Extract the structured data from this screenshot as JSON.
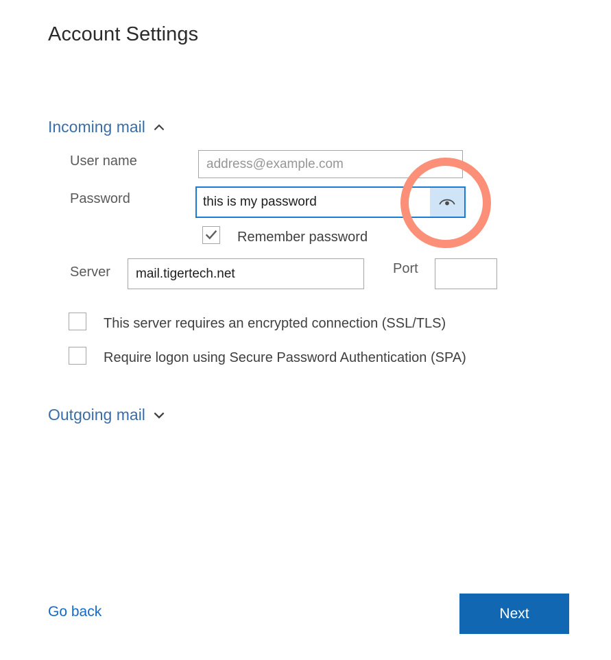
{
  "page": {
    "title": "Account Settings"
  },
  "sections": {
    "incoming": {
      "label": "Incoming mail",
      "chevron": "chevron-up-icon",
      "expanded": true
    },
    "outgoing": {
      "label": "Outgoing mail",
      "chevron": "chevron-down-icon",
      "expanded": false
    }
  },
  "fields": {
    "username": {
      "label": "User name",
      "value": "",
      "placeholder": "address@example.com"
    },
    "password": {
      "label": "Password",
      "value": "this is my password",
      "placeholder": "",
      "focused": true,
      "reveal_icon": "eye-icon"
    },
    "server": {
      "label": "Server",
      "value": "mail.tigertech.net",
      "placeholder": ""
    },
    "port": {
      "label": "Port",
      "value": "",
      "placeholder": ""
    }
  },
  "checkboxes": {
    "remember_password": {
      "label": "Remember password",
      "checked": true
    },
    "ssl": {
      "label": "This server requires an encrypted connection (SSL/TLS)",
      "checked": false
    },
    "spa": {
      "label": "Require logon using Secure Password Authentication (SPA)",
      "checked": false
    }
  },
  "footer": {
    "go_back": "Go back",
    "next": "Next"
  },
  "annotation": {
    "type": "highlight-ring",
    "target": "reveal-password-button",
    "color": "#fb8f78"
  },
  "colors": {
    "link": "#1569c8",
    "section_header": "#3a6ea5",
    "focus_border": "#1a7ad4",
    "reveal_button_bg": "#cfe4f7",
    "primary_button_bg": "#1167b2",
    "annotation": "#fb8f78"
  }
}
